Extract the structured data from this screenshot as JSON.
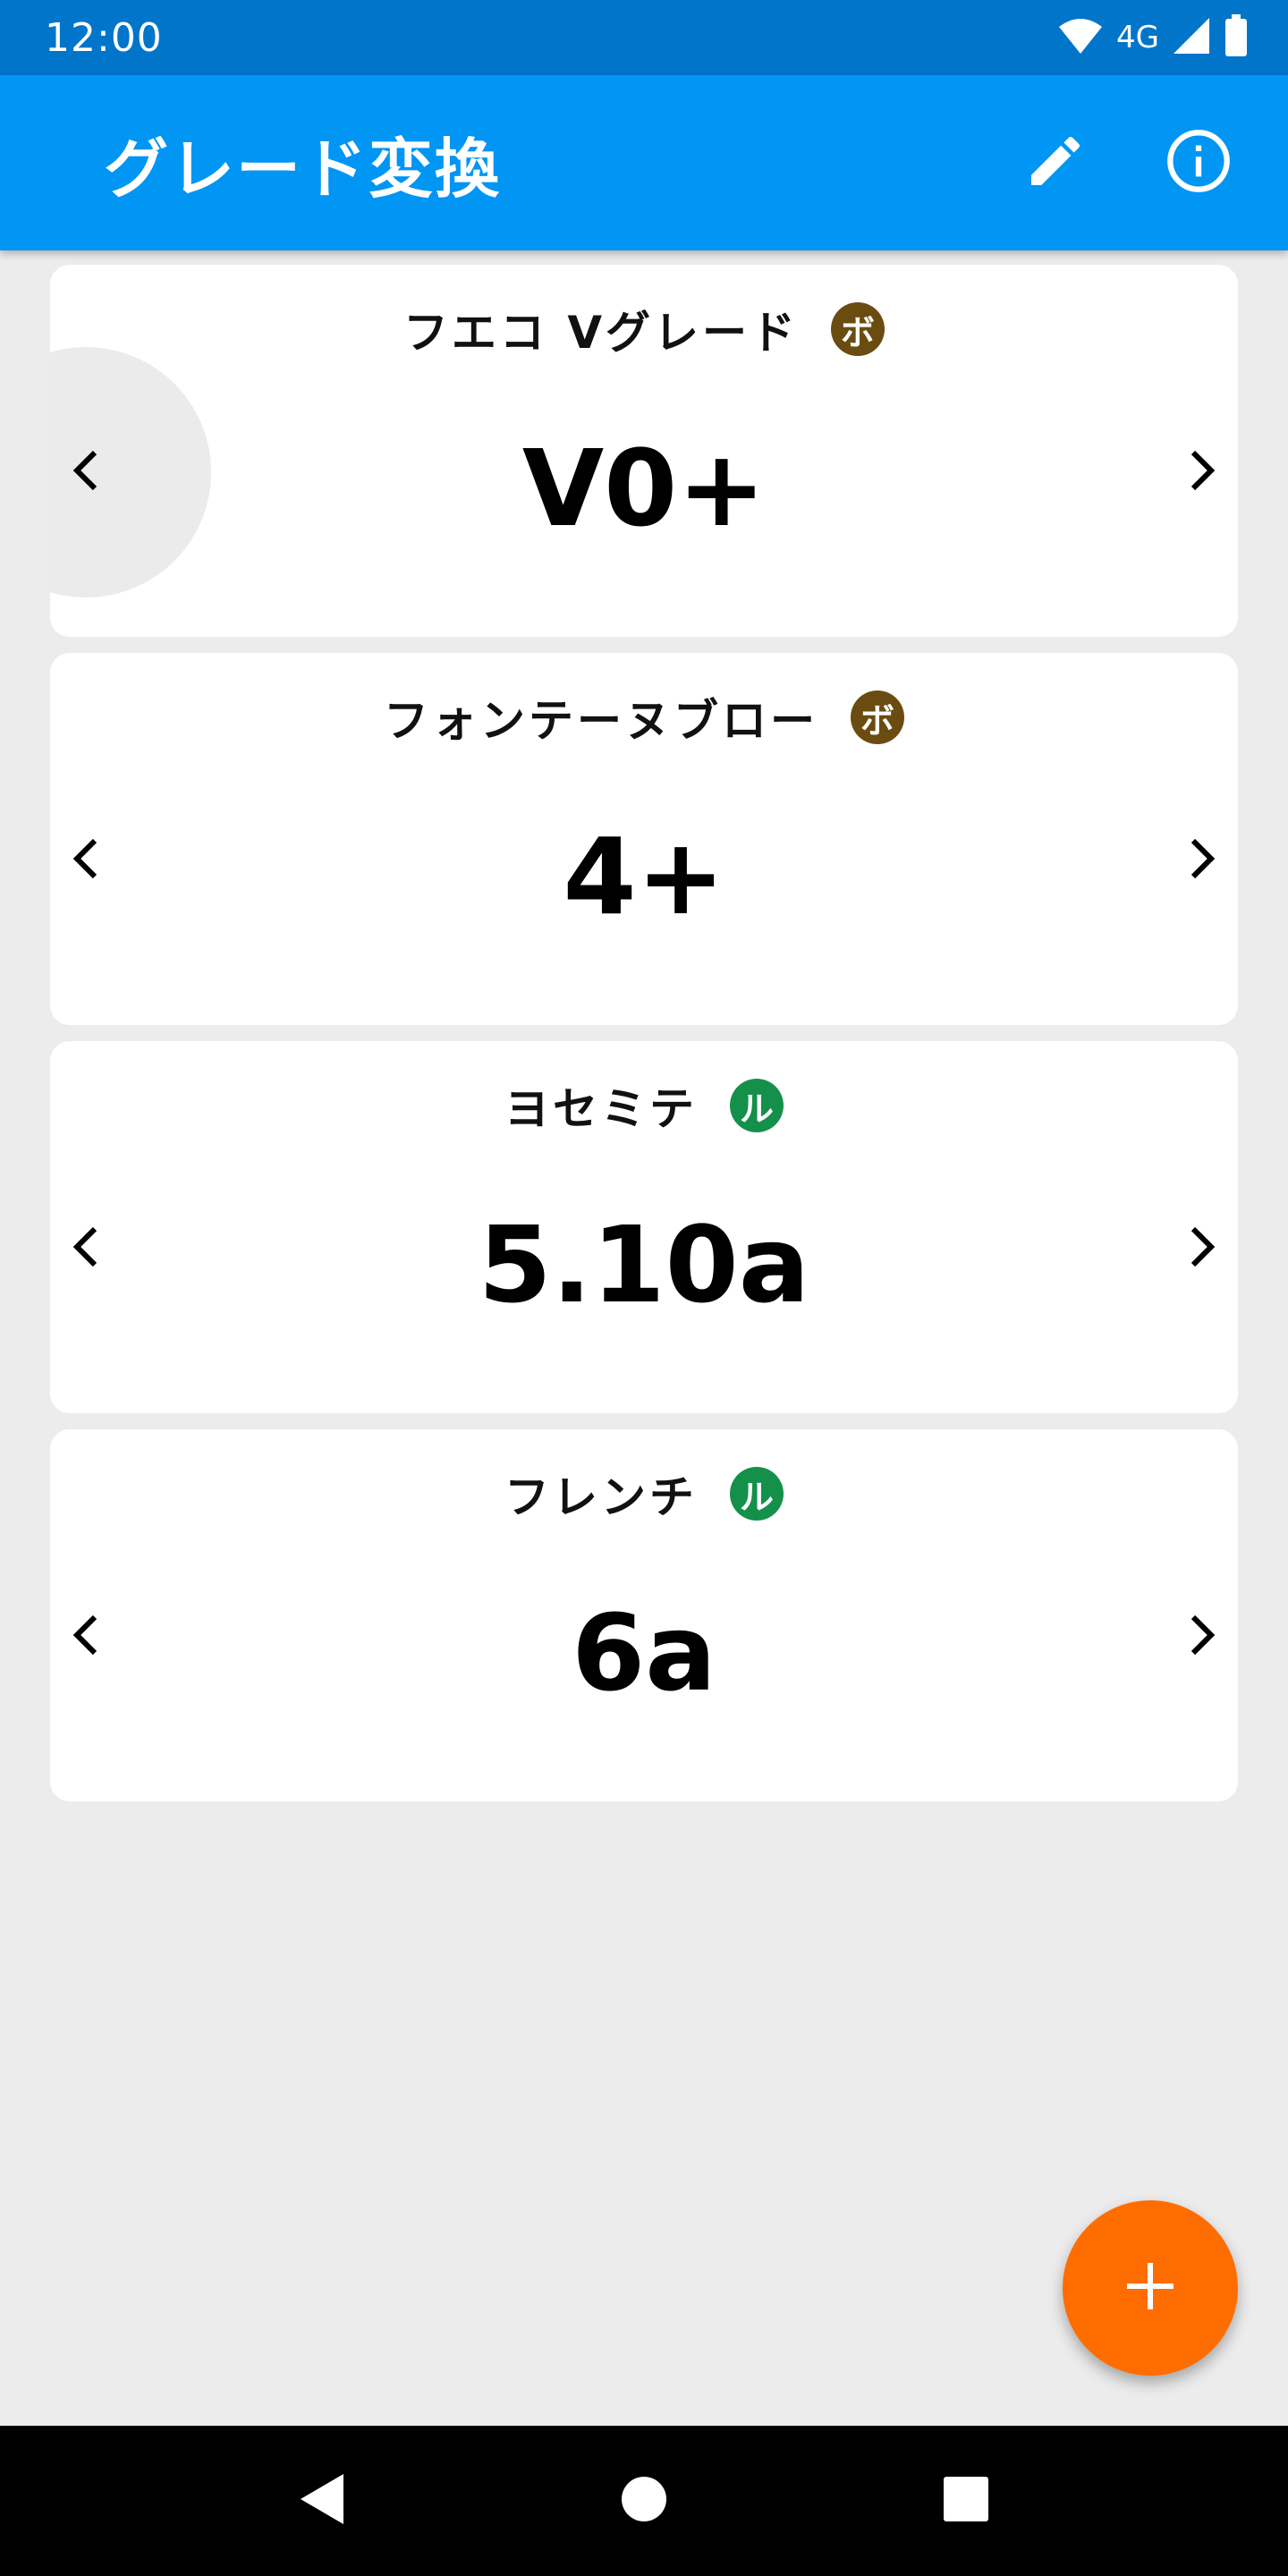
{
  "status_bar": {
    "time": "12:00",
    "network": "4G",
    "icons": [
      "wifi-icon",
      "cell-signal-icon",
      "battery-icon"
    ]
  },
  "app_bar": {
    "title": "グレード変換",
    "actions": [
      "edit-icon",
      "info-icon"
    ]
  },
  "cards": [
    {
      "title": "フエコ Vグレード",
      "badge": "ボ",
      "badge_type": "boulder",
      "value": "V0+"
    },
    {
      "title": "フォンテーヌブロー",
      "badge": "ボ",
      "badge_type": "boulder",
      "value": "4+"
    },
    {
      "title": "ヨセミテ",
      "badge": "ル",
      "badge_type": "lead",
      "value": "5.10a"
    },
    {
      "title": "フレンチ",
      "badge": "ル",
      "badge_type": "lead",
      "value": "6a"
    }
  ],
  "colors": {
    "status_bar": "#0175ca",
    "app_bar": "#0195f4",
    "background": "#ececec",
    "badge_boulder": "#6b4c10",
    "badge_lead": "#14904a",
    "fab": "#ff6d00"
  },
  "fab": {
    "icon": "plus-icon"
  },
  "nav_bar": {
    "buttons": [
      "back-icon",
      "home-icon",
      "recents-icon"
    ]
  }
}
